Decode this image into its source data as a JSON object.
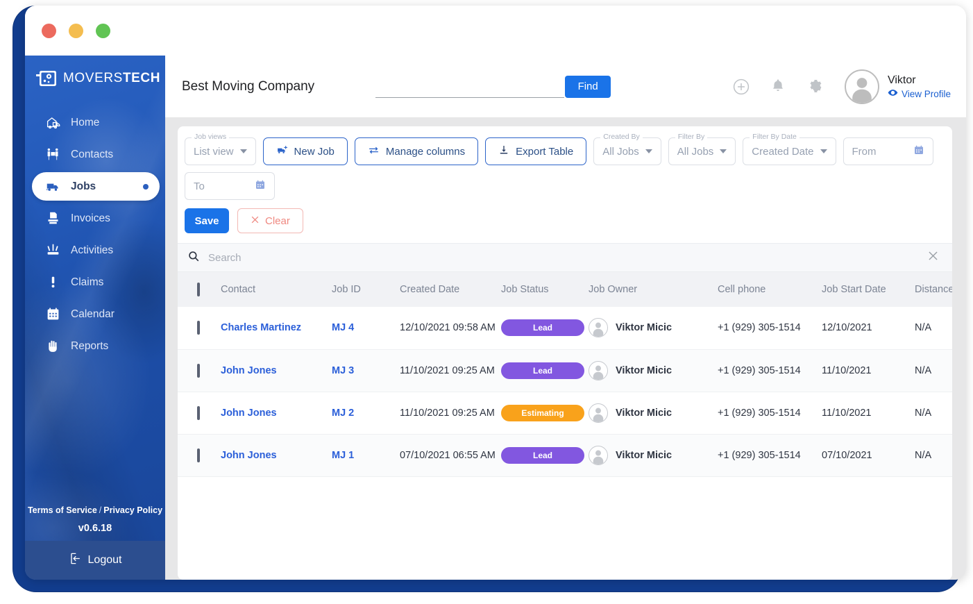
{
  "window": {
    "traffic_lights": [
      "close",
      "minimize",
      "maximize"
    ]
  },
  "sidebar": {
    "logo": {
      "text_light": "MOVERS",
      "text_bold": "TECH",
      "icon": "safe-box-icon"
    },
    "items": [
      {
        "label": "Home",
        "icon": "home-truck-icon",
        "active": false
      },
      {
        "label": "Contacts",
        "icon": "contacts-icon",
        "active": false
      },
      {
        "label": "Jobs",
        "icon": "truck-icon",
        "active": true
      },
      {
        "label": "Invoices",
        "icon": "invoice-icon",
        "active": false
      },
      {
        "label": "Activities",
        "icon": "activities-icon",
        "active": false
      },
      {
        "label": "Claims",
        "icon": "exclamation-icon",
        "active": false
      },
      {
        "label": "Calendar",
        "icon": "calendar-icon",
        "active": false
      },
      {
        "label": "Reports",
        "icon": "hand-icon",
        "active": false
      }
    ],
    "terms_label": "Terms of Service",
    "separator": "/",
    "privacy_label": "Privacy Policy",
    "version": "v0.6.18",
    "logout_label": "Logout",
    "logout_icon": "logout-icon"
  },
  "header": {
    "company_name": "Best Moving Company",
    "search_value": "",
    "search_placeholder": "",
    "find_label": "Find",
    "icons": [
      "plus-circle-icon",
      "bell-icon",
      "gear-icon"
    ],
    "profile": {
      "name": "Viktor",
      "view_profile_label": "View Profile",
      "view_profile_icon": "eye-icon",
      "avatar": "avatar"
    }
  },
  "toolbar": {
    "job_views": {
      "legend": "Job views",
      "value": "List view"
    },
    "new_job_label": "New Job",
    "new_job_icon": "truck-plus-icon",
    "manage_columns_label": "Manage columns",
    "manage_columns_icon": "swap-arrows-icon",
    "export_table_label": "Export Table",
    "export_table_icon": "download-icon",
    "created_by": {
      "legend": "Created By",
      "value": "All Jobs"
    },
    "filter_by": {
      "legend": "Filter By",
      "value": "All Jobs"
    },
    "filter_by_date": {
      "legend": "Filter By Date",
      "value": "Created Date"
    },
    "from": {
      "placeholder": "From",
      "value": "",
      "icon": "calendar-icon"
    },
    "to": {
      "placeholder": "To",
      "value": "",
      "icon": "calendar-icon"
    },
    "save_label": "Save",
    "clear_label": "Clear",
    "clear_icon": "x-icon"
  },
  "table_search": {
    "icon": "search-icon",
    "placeholder": "Search",
    "value": "",
    "clear_icon": "close-icon"
  },
  "table": {
    "columns": [
      "Contact",
      "Job ID",
      "Created Date",
      "Job Status",
      "Job Owner",
      "Cell phone",
      "Job Start Date",
      "Distance"
    ],
    "select_all_checkbox": false,
    "rows": [
      {
        "checked": false,
        "contact": "Charles Martinez",
        "job_id": "MJ 4",
        "created_date": "12/10/2021 09:58 AM",
        "status": "Lead",
        "status_color": "#8257e0",
        "owner": "Viktor Micic",
        "cell_phone": "+1 (929) 305-1514",
        "job_start_date": "12/10/2021",
        "distance": "N/A"
      },
      {
        "checked": false,
        "contact": "John Jones",
        "job_id": "MJ 3",
        "created_date": "11/10/2021 09:25 AM",
        "status": "Lead",
        "status_color": "#8257e0",
        "owner": "Viktor Micic",
        "cell_phone": "+1 (929) 305-1514",
        "job_start_date": "11/10/2021",
        "distance": "N/A"
      },
      {
        "checked": false,
        "contact": "John Jones",
        "job_id": "MJ 2",
        "created_date": "11/10/2021 09:25 AM",
        "status": "Estimating",
        "status_color": "#f9a21b",
        "owner": "Viktor Micic",
        "cell_phone": "+1 (929) 305-1514",
        "job_start_date": "11/10/2021",
        "distance": "N/A"
      },
      {
        "checked": false,
        "contact": "John Jones",
        "job_id": "MJ 1",
        "created_date": "07/10/2021 06:55 AM",
        "status": "Lead",
        "status_color": "#8257e0",
        "owner": "Viktor Micic",
        "cell_phone": "+1 (929) 305-1514",
        "job_start_date": "07/10/2021",
        "distance": "N/A"
      }
    ]
  },
  "colors": {
    "brand_blue": "#1a73e8",
    "sidebar_blue": "#1f55b5",
    "frame_blue": "#123d8e",
    "lead_purple": "#8257e0",
    "estimating_orange": "#f9a21b",
    "link_blue": "#2b5fd9"
  }
}
